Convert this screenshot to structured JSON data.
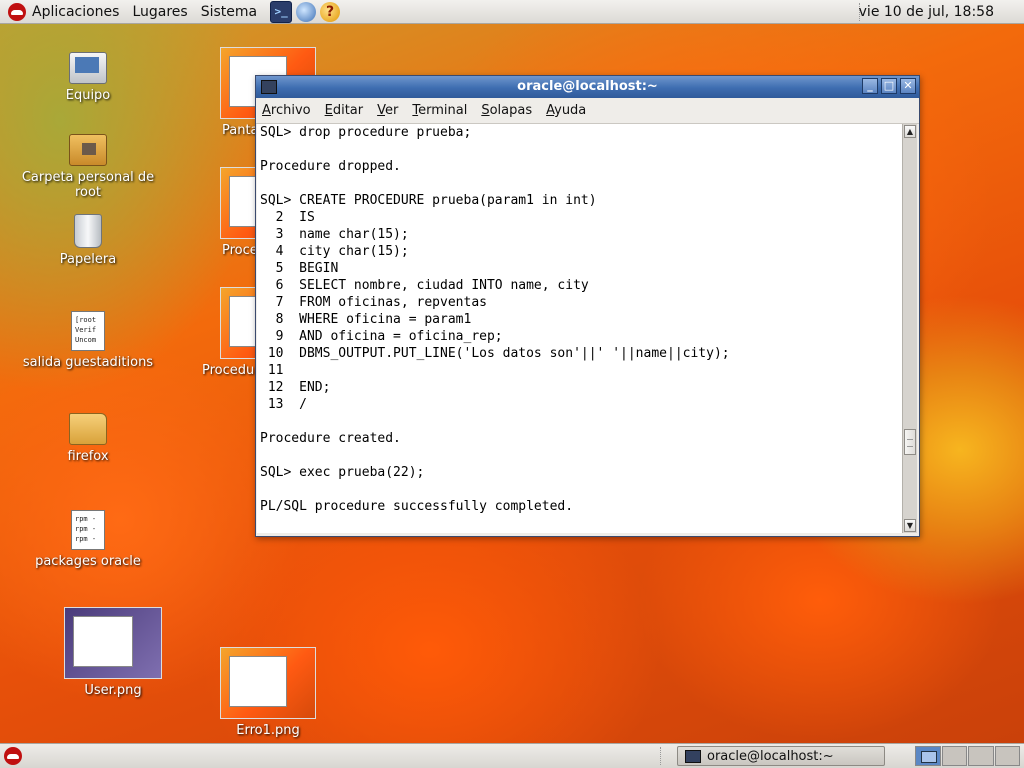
{
  "top_panel": {
    "menus": [
      "Aplicaciones",
      "Lugares",
      "Sistema"
    ],
    "launchers": {
      "terminal": "terminal-icon",
      "browser": "web-browser-icon",
      "help": "help-icon"
    },
    "clock": "vie 10 de jul, 18:58"
  },
  "desktop": {
    "icons": [
      {
        "label": "Equipo",
        "icon": "computer-icon"
      },
      {
        "label_line1": "Carpeta personal de",
        "label_line2": "root",
        "icon": "home-folder-icon"
      },
      {
        "label": "Papelera",
        "icon": "trash-icon"
      },
      {
        "label": "salida guestaditions",
        "icon": "text-file-icon",
        "preview": [
          "[root",
          "Verif",
          "Uncom"
        ]
      },
      {
        "label": "firefox",
        "icon": "folder-icon"
      },
      {
        "label": "packages oracle",
        "icon": "text-file-icon",
        "preview": [
          "rpm -",
          "rpm -",
          "rpm -",
          "rpm -"
        ]
      },
      {
        "label": "User.png",
        "icon": "image-thumbnail"
      },
      {
        "label": "Erro1.png",
        "icon": "image-thumbnail"
      },
      {
        "label": "Panta",
        "icon": "image-thumbnail"
      },
      {
        "label": "Proce",
        "icon": "image-thumbnail"
      },
      {
        "label": "Procedu",
        "icon": "image-thumbnail"
      }
    ]
  },
  "window": {
    "title": "oracle@localhost:~",
    "buttons": {
      "minimize": "_",
      "maximize": "□",
      "close": "✕"
    },
    "menu": [
      "Archivo",
      "Editar",
      "Ver",
      "Terminal",
      "Solapas",
      "Ayuda"
    ],
    "lines": [
      "SQL> drop procedure prueba;",
      "",
      "Procedure dropped.",
      "",
      "SQL> CREATE PROCEDURE prueba(param1 in int)",
      "  2  IS",
      "  3  name char(15);",
      "  4  city char(15);",
      "  5  BEGIN",
      "  6  SELECT nombre, ciudad INTO name, city",
      "  7  FROM oficinas, repventas",
      "  8  WHERE oficina = param1",
      "  9  AND oficina = oficina_rep;",
      " 10  DBMS_OUTPUT.PUT_LINE('Los datos son'||' '||name||city);",
      " 11",
      " 12  END;",
      " 13  /",
      "",
      "Procedure created.",
      "",
      "SQL> exec prueba(22);",
      "",
      "PL/SQL procedure successfully completed.",
      ""
    ],
    "scroll_position": 0.82
  },
  "bottom_panel": {
    "task": "oracle@localhost:~",
    "workspaces": 4,
    "active_workspace": 1
  },
  "colors": {
    "titlebar": "#3e6db0",
    "panel": "#e6e4df"
  }
}
